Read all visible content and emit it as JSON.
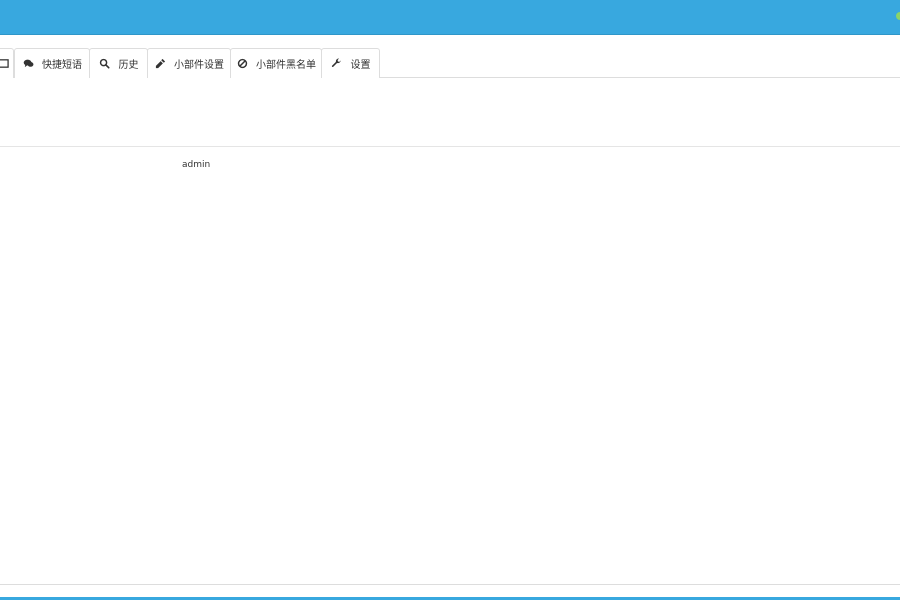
{
  "tabs": [
    {
      "label": "",
      "icon": "window-icon"
    },
    {
      "label": "快捷短语",
      "icon": "comments-icon"
    },
    {
      "label": "历史",
      "icon": "search-icon"
    },
    {
      "label": "小部件设置",
      "icon": "eyedropper-icon"
    },
    {
      "label": "小部件黑名单",
      "icon": "ban-icon"
    },
    {
      "label": "设置",
      "icon": "wrench-icon"
    }
  ],
  "profile": {
    "username": "admin"
  },
  "colors": {
    "header": "#38a8df",
    "status": "#8bd46a"
  }
}
